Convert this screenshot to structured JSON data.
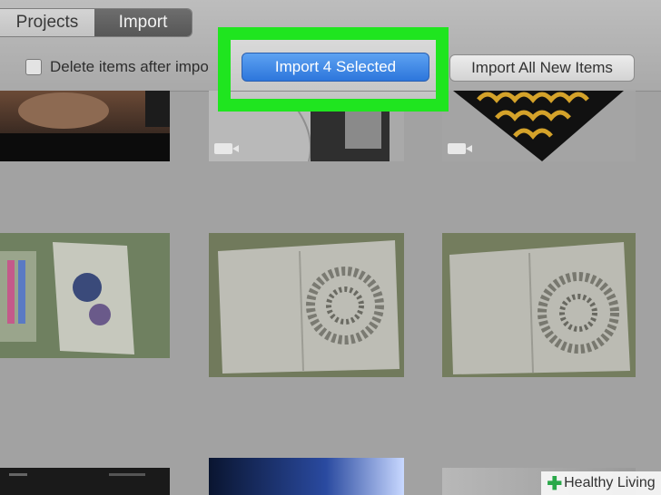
{
  "tabs": [
    {
      "label": "Projects",
      "active": false
    },
    {
      "label": "Import",
      "active": true
    }
  ],
  "options": {
    "delete_after_import_label": "Delete items after impo",
    "delete_after_import_checked": false
  },
  "buttons": {
    "import_selected": "Import 4 Selected",
    "import_all": "Import All New Items"
  },
  "watermark": {
    "text": "Healthy Living"
  },
  "colors": {
    "highlight": "#1fe51f",
    "primary_button": "#3a85e6"
  },
  "icons": [
    "video-camera-icon",
    "checkbox-icon"
  ]
}
